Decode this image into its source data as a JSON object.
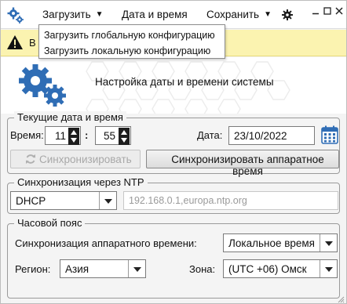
{
  "menubar": {
    "load_label": "Загрузить",
    "datetime_label": "Дата и время",
    "save_label": "Сохранить"
  },
  "dropdown": {
    "items": [
      "Загрузить глобальную конфигурацию",
      "Загрузить локальную конфигурацию"
    ]
  },
  "banner": {
    "text_visible": "В"
  },
  "header": {
    "title": "Настройка даты и времени системы"
  },
  "current_datetime": {
    "legend": "Текущие дата и время",
    "time_label": "Время:",
    "hour": "11",
    "minute": "55",
    "date_label": "Дата:",
    "date_value": "23/10/2022",
    "sync_button": "Синхронизировать",
    "sync_hw_button": "Синхронизировать аппаратное время"
  },
  "ntp": {
    "legend": "Синхронизация через NTP",
    "mode_value": "DHCP",
    "servers_placeholder": "192.168.0.1,europa.ntp.org"
  },
  "timezone": {
    "legend": "Часовой пояс",
    "hw_sync_label": "Синхронизация аппаратного времени:",
    "hw_sync_value": "Локальное время",
    "region_label": "Регион:",
    "region_value": "Азия",
    "zone_label": "Зона:",
    "zone_value": "(UTC +06) Омск"
  },
  "colors": {
    "accent_blue": "#2f6db5",
    "banner_yellow": "#fbf3b0"
  }
}
